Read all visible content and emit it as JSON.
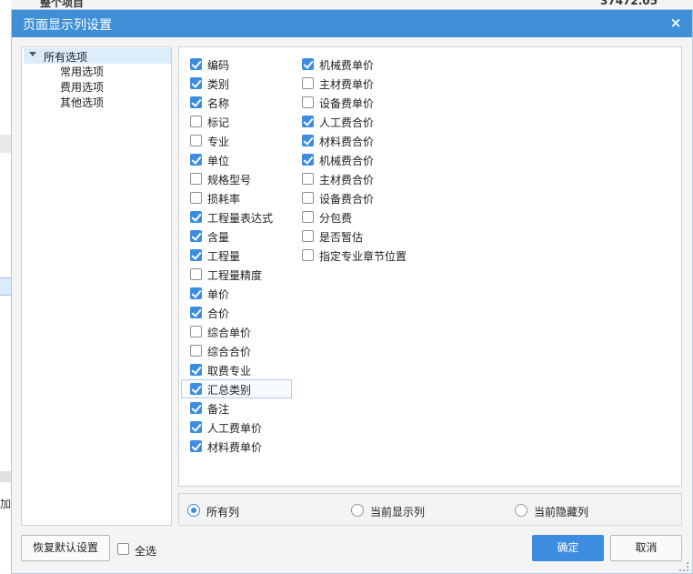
{
  "background": {
    "top_left_text": "整个项目",
    "top_right_text": "37472.05",
    "left_cut_text": "加成"
  },
  "dialog": {
    "title": "页面显示列设置",
    "close_glyph": "×"
  },
  "tree": {
    "root": "所有选项",
    "children": [
      "常用选项",
      "费用选项",
      "其他选项"
    ]
  },
  "columns_left": [
    {
      "label": "编码",
      "checked": true
    },
    {
      "label": "类别",
      "checked": true
    },
    {
      "label": "名称",
      "checked": true
    },
    {
      "label": "标记",
      "checked": false
    },
    {
      "label": "专业",
      "checked": false
    },
    {
      "label": "单位",
      "checked": true
    },
    {
      "label": "规格型号",
      "checked": false
    },
    {
      "label": "损耗率",
      "checked": false
    },
    {
      "label": "工程量表达式",
      "checked": true
    },
    {
      "label": "含量",
      "checked": true
    },
    {
      "label": "工程量",
      "checked": true
    },
    {
      "label": "工程量精度",
      "checked": false
    },
    {
      "label": "单价",
      "checked": true
    },
    {
      "label": "合价",
      "checked": true
    },
    {
      "label": "综合单价",
      "checked": false
    },
    {
      "label": "综合合价",
      "checked": false
    },
    {
      "label": "取费专业",
      "checked": true
    },
    {
      "label": "汇总类别",
      "checked": true
    },
    {
      "label": "备注",
      "checked": true
    },
    {
      "label": "人工费单价",
      "checked": true
    },
    {
      "label": "材料费单价",
      "checked": true
    }
  ],
  "columns_right": [
    {
      "label": "机械费单价",
      "checked": true
    },
    {
      "label": "主材费单价",
      "checked": false
    },
    {
      "label": "设备费单价",
      "checked": false
    },
    {
      "label": "人工费合价",
      "checked": true
    },
    {
      "label": "材料费合价",
      "checked": true
    },
    {
      "label": "机械费合价",
      "checked": true
    },
    {
      "label": "主材费合价",
      "checked": false
    },
    {
      "label": "设备费合价",
      "checked": false
    },
    {
      "label": "分包费",
      "checked": false
    },
    {
      "label": "是否暂估",
      "checked": false
    },
    {
      "label": "指定专业章节位置",
      "checked": false
    }
  ],
  "focused_item": "汇总类别",
  "filter_radios": [
    {
      "label": "所有列",
      "selected": true
    },
    {
      "label": "当前显示列",
      "selected": false
    },
    {
      "label": "当前隐藏列",
      "selected": false
    }
  ],
  "footer": {
    "restore_label": "恢复默认设置",
    "select_all_label": "全选",
    "select_all_checked": false,
    "ok_label": "确定",
    "cancel_label": "取消"
  },
  "colors": {
    "titlebar": "#3f8fd6",
    "accent": "#3c8de0",
    "tree_selected": "#dcecfb"
  }
}
